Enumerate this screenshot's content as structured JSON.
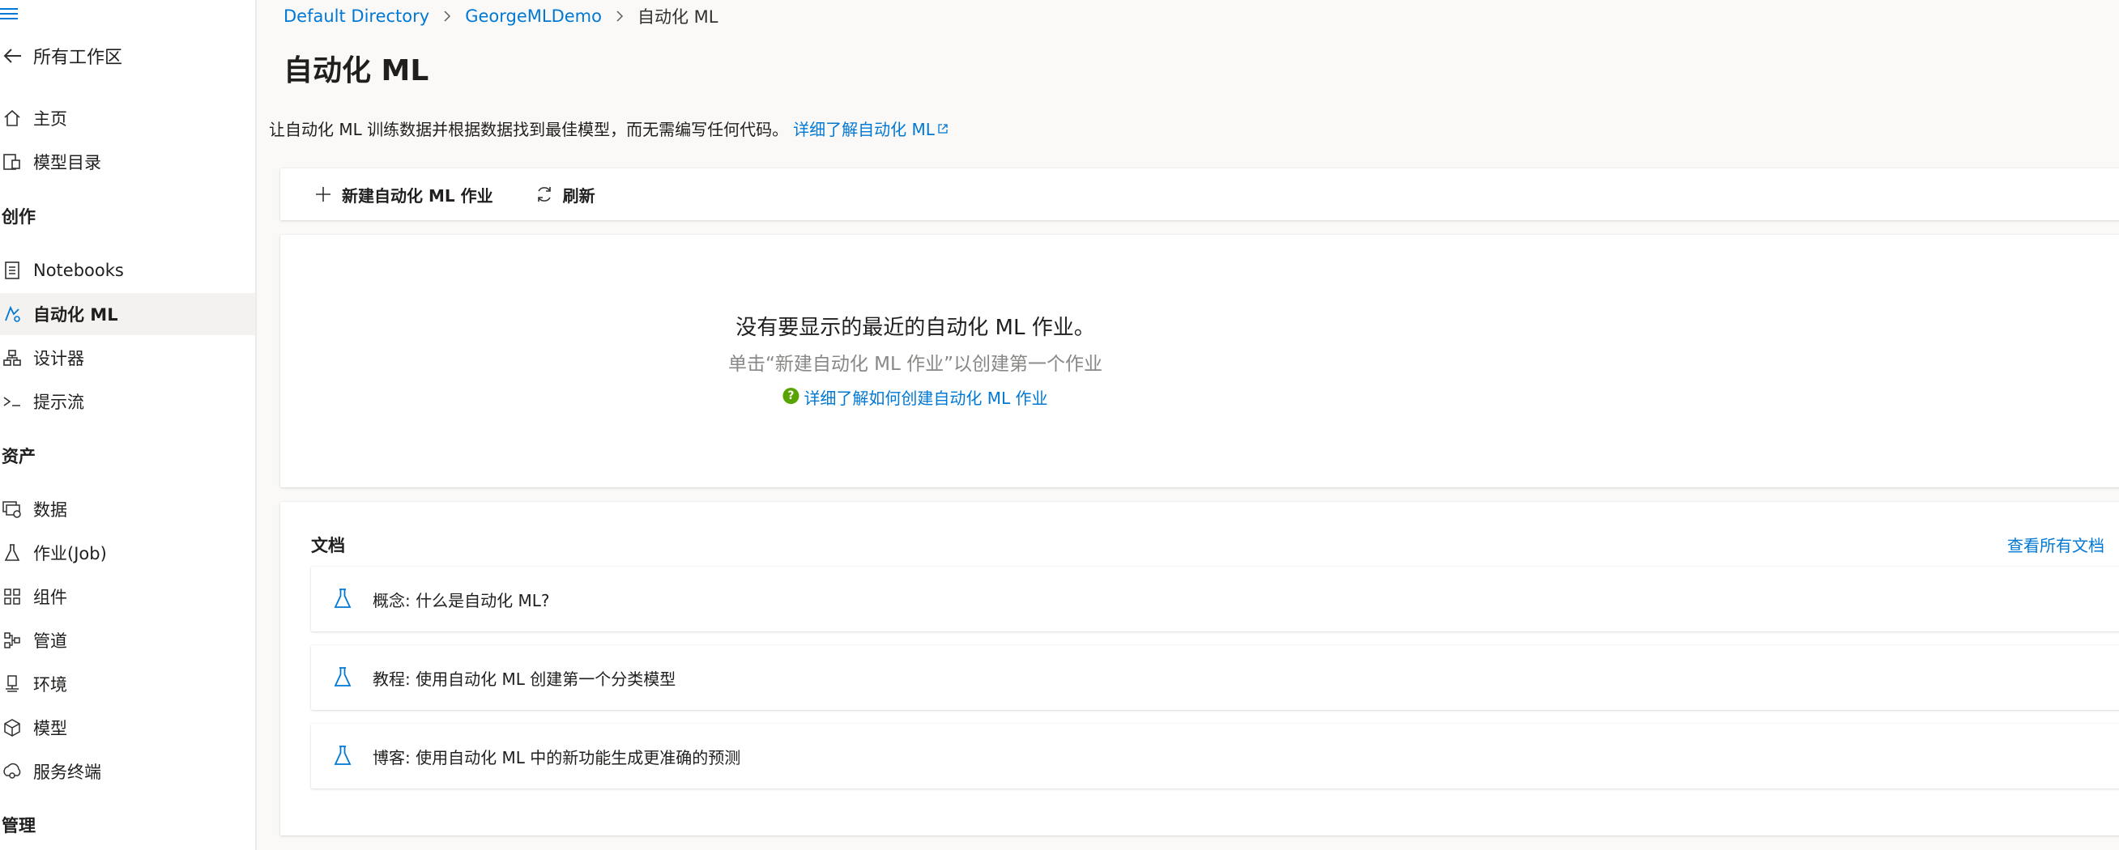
{
  "sidebar": {
    "back_label": "所有工作区",
    "items_top": [
      {
        "label": "主页",
        "icon": "home-icon"
      },
      {
        "label": "模型目录",
        "icon": "model-catalog-icon"
      }
    ],
    "section_create": "创作",
    "items_create": [
      {
        "label": "Notebooks",
        "icon": "notebook-icon"
      },
      {
        "label": "自动化 ML",
        "icon": "automl-icon",
        "active": true
      },
      {
        "label": "设计器",
        "icon": "designer-icon"
      },
      {
        "label": "提示流",
        "icon": "prompt-flow-icon"
      }
    ],
    "section_assets": "资产",
    "items_assets": [
      {
        "label": "数据",
        "icon": "data-icon"
      },
      {
        "label": "作业(Job)",
        "icon": "flask-icon"
      },
      {
        "label": "组件",
        "icon": "components-icon"
      },
      {
        "label": "管道",
        "icon": "pipeline-icon"
      },
      {
        "label": "环境",
        "icon": "environment-icon"
      },
      {
        "label": "模型",
        "icon": "cube-icon"
      },
      {
        "label": "服务终端",
        "icon": "endpoint-icon"
      }
    ],
    "section_manage": "管理"
  },
  "breadcrumb": {
    "items": [
      "Default Directory",
      "GeorgeMLDemo"
    ],
    "current": "自动化 ML"
  },
  "page": {
    "title": "自动化 ML",
    "description": "让自动化 ML 训练数据并根据数据找到最佳模型，而无需编写任何代码。",
    "learn_more": "详细了解自动化 ML"
  },
  "toolbar": {
    "new_job_label": "新建自动化 ML 作业",
    "refresh_label": "刷新"
  },
  "empty_state": {
    "title": "没有要显示的最近的自动化 ML 作业。",
    "subtitle": "单击“新建自动化 ML 作业”以创建第一个作业",
    "link": "详细了解如何创建自动化 ML 作业",
    "help_glyph": "?"
  },
  "docs": {
    "title": "文档",
    "view_all": "查看所有文档",
    "items": [
      "概念: 什么是自动化 ML?",
      "教程: 使用自动化 ML 创建第一个分类模型",
      "博客: 使用自动化 ML 中的新功能生成更准确的预测"
    ]
  },
  "colors": {
    "accent": "#0078d4",
    "help_green": "#57a300"
  }
}
